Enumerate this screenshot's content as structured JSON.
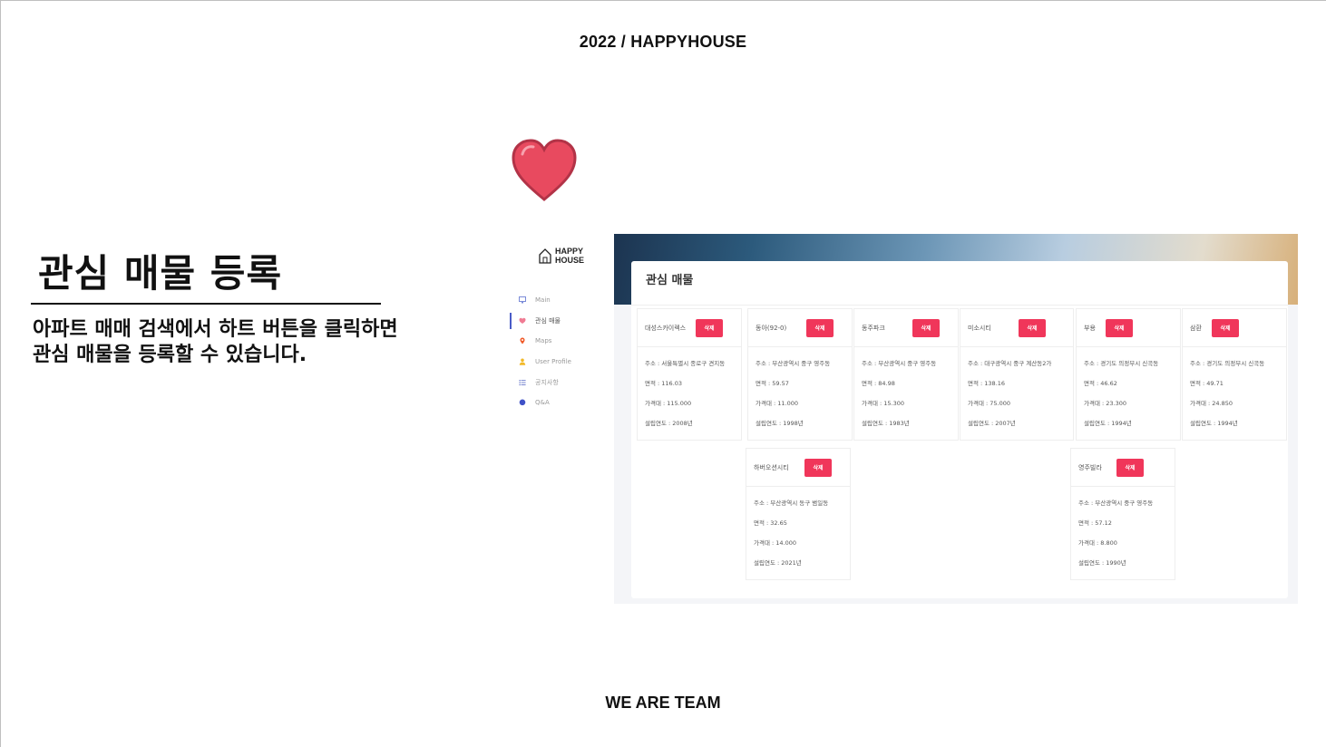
{
  "slide": {
    "header": "2022 / HAPPYHOUSE",
    "footer": "WE ARE TEAM",
    "heading": "관심 매물 등록",
    "description_line1": "아파트 매매 검색에서 하트 버튼을 클릭하면",
    "description_line2": "관심 매물을 등록할 수 있습니다."
  },
  "logo": {
    "line1": "HAPPY",
    "line2": "HOUSE"
  },
  "sidebar": {
    "items": [
      {
        "label": "Main",
        "icon": "monitor-icon",
        "color": "#7a8bd8"
      },
      {
        "label": "관심 매물",
        "icon": "heart-icon",
        "color": "#f07b93",
        "active": true
      },
      {
        "label": "Maps",
        "icon": "pin-icon",
        "color": "#f05a28"
      },
      {
        "label": "User Profile",
        "icon": "user-icon",
        "color": "#f2b928"
      },
      {
        "label": "공지사항",
        "icon": "list-icon",
        "color": "#6b7acb"
      },
      {
        "label": "Q&A",
        "icon": "chat-bubble-icon",
        "color": "#3f51c7"
      }
    ]
  },
  "panel": {
    "title": "관심 매물",
    "delete_label": "삭제",
    "labels": {
      "address": "주소",
      "area": "면적",
      "price": "가격대",
      "year": "설립연도"
    },
    "properties": [
      {
        "name": "대성스카이렉스",
        "address": "주소 : 서울특별시 종로구 견지동",
        "area": "면적 : 116.03",
        "price": "가격대 : 115.000",
        "year": "설립연도 : 2008년"
      },
      {
        "name": "동아(92-0)",
        "address": "주소 : 부산광역시 중구 영주동",
        "area": "면적 : 59.57",
        "price": "가격대 : 11.000",
        "year": "설립연도 : 1998년"
      },
      {
        "name": "동주파크",
        "address": "주소 : 부산광역시 중구 영주동",
        "area": "면적 : 84.98",
        "price": "가격대 : 15.300",
        "year": "설립연도 : 1983년"
      },
      {
        "name": "미소시티",
        "address": "주소 : 대구광역시 중구 계산동2가",
        "area": "면적 : 138.16",
        "price": "가격대 : 75.000",
        "year": "설립연도 : 2007년"
      },
      {
        "name": "부용",
        "address": "주소 : 경기도 의정부시 신곡동",
        "area": "면적 : 46.62",
        "price": "가격대 : 23.300",
        "year": "설립연도 : 1994년"
      },
      {
        "name": "삼환",
        "address": "주소 : 경기도 의정부시 신곡동",
        "area": "면적 : 49.71",
        "price": "가격대 : 24.850",
        "year": "설립연도 : 1994년"
      },
      {
        "name": "하버오션시티",
        "address": "주소 : 부산광역시 동구 범일동",
        "area": "면적 : 32.65",
        "price": "가격대 : 14.000",
        "year": "설립연도 : 2021년"
      },
      {
        "name": "영주빌라",
        "address": "주소 : 부산광역시 중구 영주동",
        "area": "면적 : 57.12",
        "price": "가격대 : 8.800",
        "year": "설립연도 : 1990년"
      }
    ]
  },
  "colors": {
    "accent": "#f0365a",
    "heart": "#e84a5f",
    "nav_active": "#4a5cc8"
  }
}
